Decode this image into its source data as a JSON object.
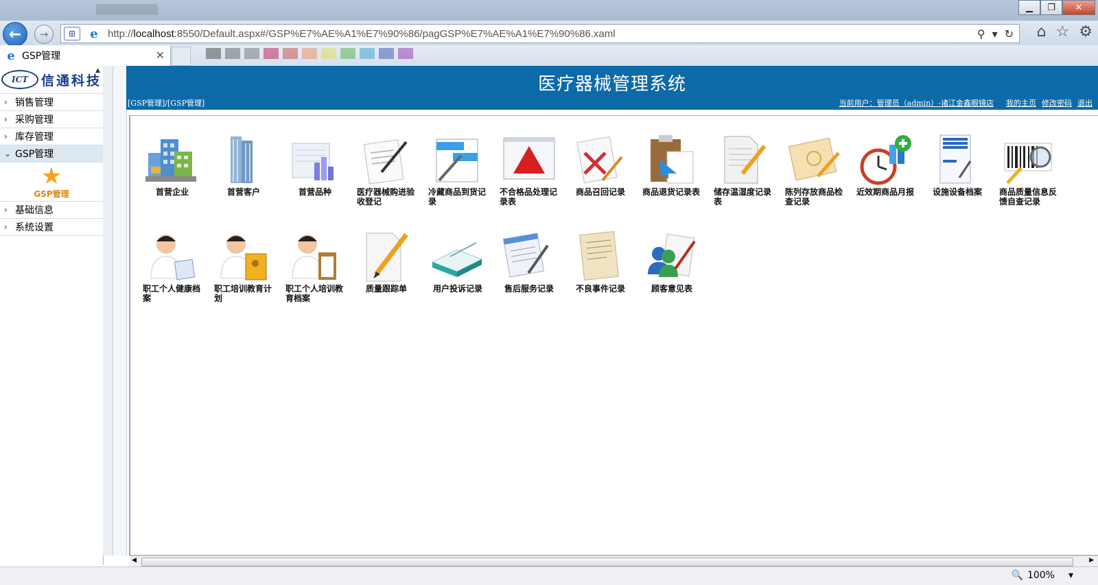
{
  "browser": {
    "url_prefix": "http://",
    "url_host": "localhost",
    "url_rest": ":8550/Default.aspx#/GSP%E7%AE%A1%E7%90%86/pagGSP%E7%AE%A1%E7%90%86.xaml",
    "tab_title": "GSP管理",
    "zoom": "100%"
  },
  "sidebar": {
    "logo_mark": "ICT",
    "logo_text": "信通科技",
    "items": [
      {
        "label": "销售管理"
      },
      {
        "label": "采购管理"
      },
      {
        "label": "库存管理"
      },
      {
        "label": "GSP管理"
      },
      {
        "label": "基础信息"
      },
      {
        "label": "系统设置"
      }
    ],
    "active_sub": "GSP管理"
  },
  "header": {
    "title": "医疗器械管理系统",
    "breadcrumb": "[GSP管理]/[GSP管理]",
    "current_user": "当前用户：管理员（admin）-诸江金鑫眼镜店",
    "my_home": "我的主页",
    "change_password": "修改密码",
    "logout": "退出"
  },
  "modules": {
    "row1": [
      {
        "label": "首营企业",
        "icon": "buildings-icon"
      },
      {
        "label": "首营客户",
        "icon": "tower-icon"
      },
      {
        "label": "首营品种",
        "icon": "chart-doc-icon"
      },
      {
        "label": "医疗器械购进验收登记",
        "icon": "sign-doc-icon"
      },
      {
        "label": "冷藏商品到货记录",
        "icon": "window-pen-icon"
      },
      {
        "label": "不合格品处理记录表",
        "icon": "warning-icon"
      },
      {
        "label": "商品召回记录",
        "icon": "reject-doc-icon"
      },
      {
        "label": "商品退货记录表",
        "icon": "clipboard-icon"
      },
      {
        "label": "储存温湿度记录表",
        "icon": "note-pencil-icon"
      },
      {
        "label": "陈列存放商品检查记录",
        "icon": "notebook-icon"
      },
      {
        "label": "近效期商品月报",
        "icon": "clock-icon"
      },
      {
        "label": "设施设备档案",
        "icon": "file-cabinet-icon"
      },
      {
        "label": "商品质量信息反馈自查记录",
        "icon": "barcode-icon"
      }
    ],
    "row2": [
      {
        "label": "职工个人健康档案",
        "icon": "doctor-icon"
      },
      {
        "label": "职工培训教育计划",
        "icon": "doctor-book-icon"
      },
      {
        "label": "职工个人培训教育档案",
        "icon": "doctor-clipboard-icon"
      },
      {
        "label": "质量跟踪单",
        "icon": "paper-pencil-icon"
      },
      {
        "label": "用户投诉记录",
        "icon": "book-stack-icon"
      },
      {
        "label": "售后服务记录",
        "icon": "doc-pen-icon"
      },
      {
        "label": "不良事件记录",
        "icon": "old-paper-icon"
      },
      {
        "label": "顾客意见表",
        "icon": "users-doc-icon"
      }
    ]
  }
}
